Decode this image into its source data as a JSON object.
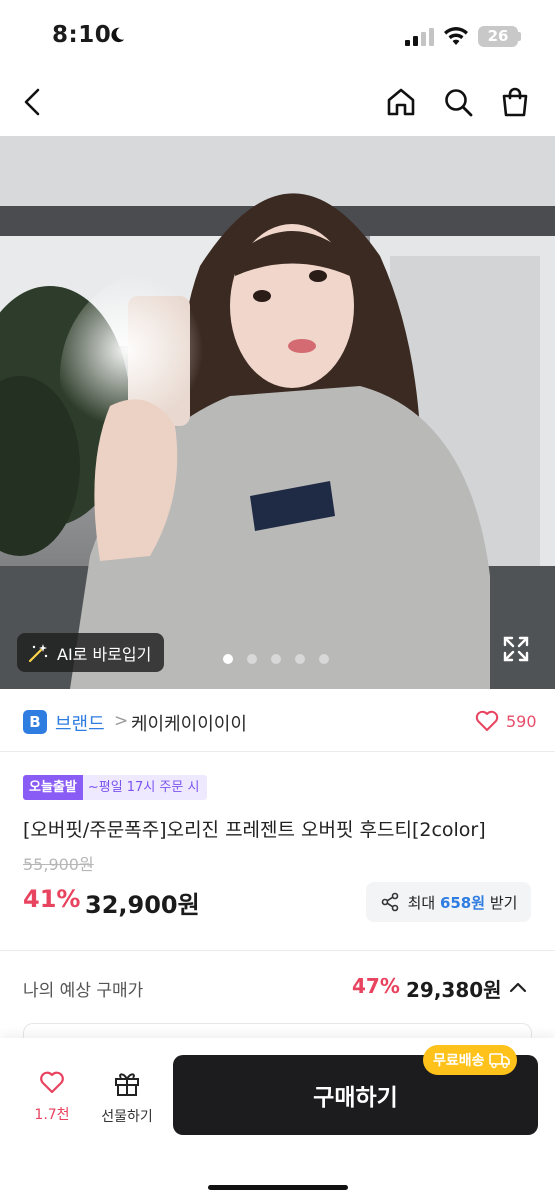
{
  "status_bar": {
    "time": "8:10",
    "battery": "26"
  },
  "header": {
    "back_icon": "chevron-left-icon",
    "home_icon": "home-icon",
    "search_icon": "search-icon",
    "bag_icon": "shopping-bag-icon"
  },
  "hero": {
    "ai_button_label": "AI로 바로입기",
    "slide_count": 5,
    "active_slide": 1,
    "expand_icon": "expand-icon"
  },
  "brand": {
    "badge": "B",
    "label": "브랜드",
    "separator": ">",
    "name": "케이케이이이이",
    "like_count": "590"
  },
  "product": {
    "tag_today": "오늘출발",
    "tag_condition": "~평일 17시 주문 시",
    "title": "[오버핏/주문폭주]오리진 프레젠트 오버핏 후드티[2color]",
    "original_price": "55,900원",
    "discount": "41%",
    "price": "32,900원",
    "share": {
      "prefix": "최대 ",
      "amount": "658원",
      "suffix": " 받기"
    }
  },
  "expected": {
    "label": "나의 예상 구매가",
    "discount": "47%",
    "price": "29,380원"
  },
  "bottom_bar": {
    "like_count": "1.7천",
    "gift_label": "선물하기",
    "buy_label": "구매하기",
    "free_shipping": "무료배송"
  },
  "colors": {
    "accent_red": "#e8435f",
    "accent_blue": "#2f7de1",
    "accent_purple": "#8a5cf6",
    "free_ship_yellow": "#ffc21a",
    "buy_button": "#1c1c1e"
  }
}
